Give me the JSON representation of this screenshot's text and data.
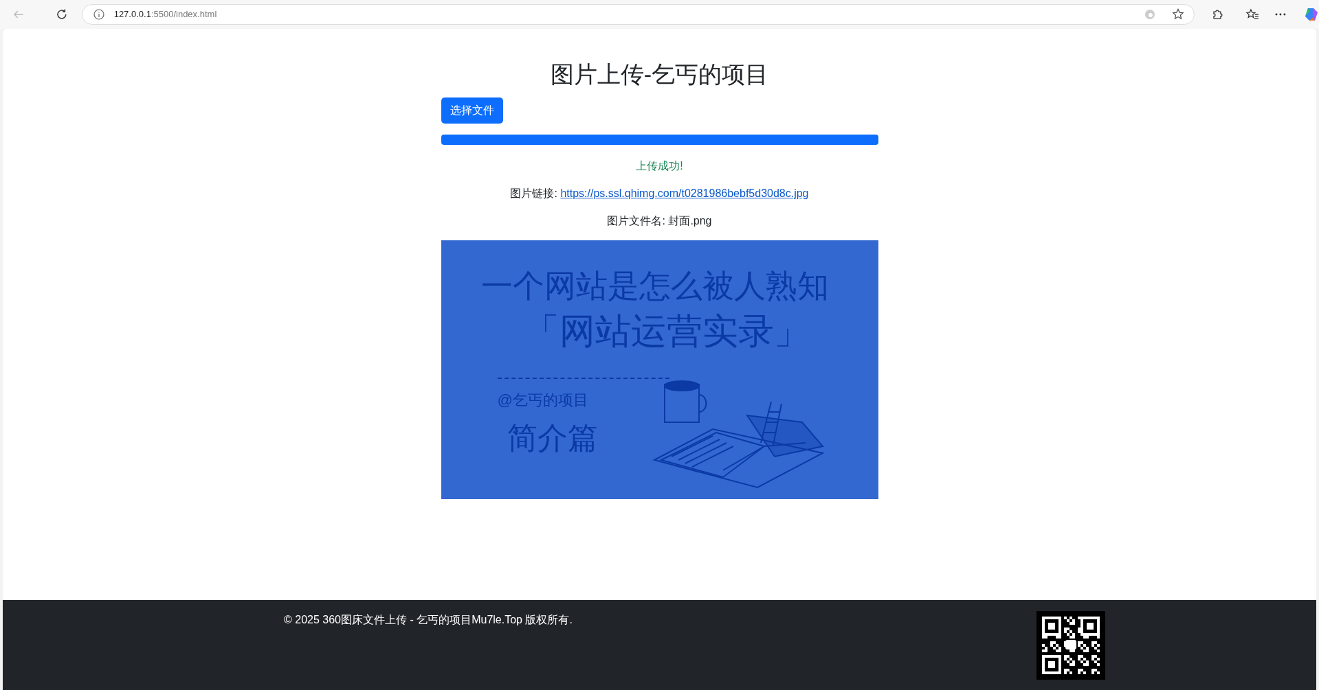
{
  "browser": {
    "url_host": "127.0.0.1",
    "url_rest": ":5500/index.html"
  },
  "page": {
    "title": "图片上传-乞丐的项目",
    "choose_button": "选择文件",
    "progress": {
      "level": 1.0
    },
    "status": "上传成功!",
    "link_label": "图片链接:",
    "link_url": "https://ps.ssl.qhimg.com/t0281986bebf5d30d8c.jpg",
    "filename_label": "图片文件名: 封面.png",
    "image": {
      "headline": "一个网站是怎么被人熟知",
      "subtitle": "「网站运营实录」",
      "author": "@乞丐的项目",
      "section": "简介篇"
    }
  },
  "footer": {
    "copyright": "© 2025 360图床文件上传 - 乞丐的项目Mu7le.Top 版权所有."
  }
}
